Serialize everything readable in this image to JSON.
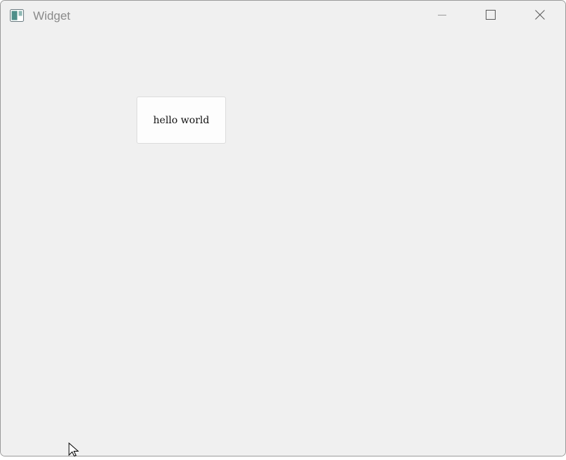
{
  "window": {
    "title": "Widget",
    "controls": {
      "minimize": "minimize-icon",
      "maximize": "maximize-icon",
      "close": "close-icon"
    }
  },
  "main": {
    "button_label": "hello world"
  },
  "colors": {
    "window_bg": "#f0f0f0",
    "title_text": "#8a8a8a",
    "button_bg": "#fdfdfd",
    "button_border": "#dcdcdc"
  }
}
